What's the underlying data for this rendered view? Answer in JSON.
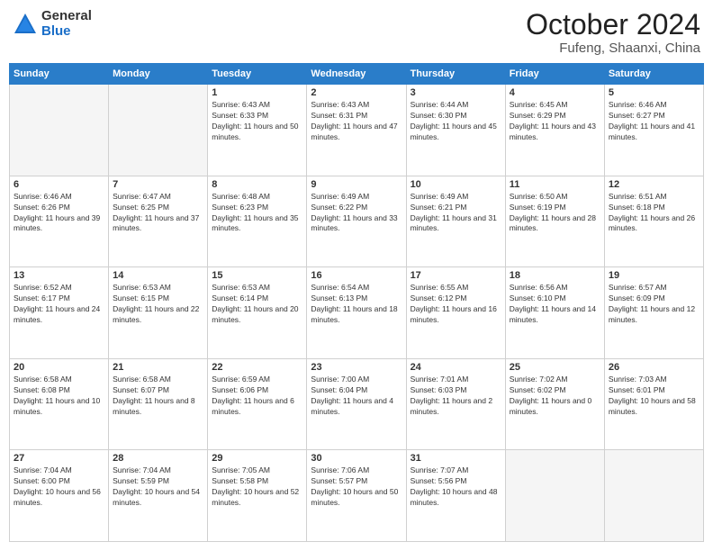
{
  "header": {
    "logo_general": "General",
    "logo_blue": "Blue",
    "month": "October 2024",
    "location": "Fufeng, Shaanxi, China"
  },
  "weekdays": [
    "Sunday",
    "Monday",
    "Tuesday",
    "Wednesday",
    "Thursday",
    "Friday",
    "Saturday"
  ],
  "weeks": [
    [
      {
        "day": "",
        "text": ""
      },
      {
        "day": "",
        "text": ""
      },
      {
        "day": "1",
        "text": "Sunrise: 6:43 AM\nSunset: 6:33 PM\nDaylight: 11 hours and 50 minutes."
      },
      {
        "day": "2",
        "text": "Sunrise: 6:43 AM\nSunset: 6:31 PM\nDaylight: 11 hours and 47 minutes."
      },
      {
        "day": "3",
        "text": "Sunrise: 6:44 AM\nSunset: 6:30 PM\nDaylight: 11 hours and 45 minutes."
      },
      {
        "day": "4",
        "text": "Sunrise: 6:45 AM\nSunset: 6:29 PM\nDaylight: 11 hours and 43 minutes."
      },
      {
        "day": "5",
        "text": "Sunrise: 6:46 AM\nSunset: 6:27 PM\nDaylight: 11 hours and 41 minutes."
      }
    ],
    [
      {
        "day": "6",
        "text": "Sunrise: 6:46 AM\nSunset: 6:26 PM\nDaylight: 11 hours and 39 minutes."
      },
      {
        "day": "7",
        "text": "Sunrise: 6:47 AM\nSunset: 6:25 PM\nDaylight: 11 hours and 37 minutes."
      },
      {
        "day": "8",
        "text": "Sunrise: 6:48 AM\nSunset: 6:23 PM\nDaylight: 11 hours and 35 minutes."
      },
      {
        "day": "9",
        "text": "Sunrise: 6:49 AM\nSunset: 6:22 PM\nDaylight: 11 hours and 33 minutes."
      },
      {
        "day": "10",
        "text": "Sunrise: 6:49 AM\nSunset: 6:21 PM\nDaylight: 11 hours and 31 minutes."
      },
      {
        "day": "11",
        "text": "Sunrise: 6:50 AM\nSunset: 6:19 PM\nDaylight: 11 hours and 28 minutes."
      },
      {
        "day": "12",
        "text": "Sunrise: 6:51 AM\nSunset: 6:18 PM\nDaylight: 11 hours and 26 minutes."
      }
    ],
    [
      {
        "day": "13",
        "text": "Sunrise: 6:52 AM\nSunset: 6:17 PM\nDaylight: 11 hours and 24 minutes."
      },
      {
        "day": "14",
        "text": "Sunrise: 6:53 AM\nSunset: 6:15 PM\nDaylight: 11 hours and 22 minutes."
      },
      {
        "day": "15",
        "text": "Sunrise: 6:53 AM\nSunset: 6:14 PM\nDaylight: 11 hours and 20 minutes."
      },
      {
        "day": "16",
        "text": "Sunrise: 6:54 AM\nSunset: 6:13 PM\nDaylight: 11 hours and 18 minutes."
      },
      {
        "day": "17",
        "text": "Sunrise: 6:55 AM\nSunset: 6:12 PM\nDaylight: 11 hours and 16 minutes."
      },
      {
        "day": "18",
        "text": "Sunrise: 6:56 AM\nSunset: 6:10 PM\nDaylight: 11 hours and 14 minutes."
      },
      {
        "day": "19",
        "text": "Sunrise: 6:57 AM\nSunset: 6:09 PM\nDaylight: 11 hours and 12 minutes."
      }
    ],
    [
      {
        "day": "20",
        "text": "Sunrise: 6:58 AM\nSunset: 6:08 PM\nDaylight: 11 hours and 10 minutes."
      },
      {
        "day": "21",
        "text": "Sunrise: 6:58 AM\nSunset: 6:07 PM\nDaylight: 11 hours and 8 minutes."
      },
      {
        "day": "22",
        "text": "Sunrise: 6:59 AM\nSunset: 6:06 PM\nDaylight: 11 hours and 6 minutes."
      },
      {
        "day": "23",
        "text": "Sunrise: 7:00 AM\nSunset: 6:04 PM\nDaylight: 11 hours and 4 minutes."
      },
      {
        "day": "24",
        "text": "Sunrise: 7:01 AM\nSunset: 6:03 PM\nDaylight: 11 hours and 2 minutes."
      },
      {
        "day": "25",
        "text": "Sunrise: 7:02 AM\nSunset: 6:02 PM\nDaylight: 11 hours and 0 minutes."
      },
      {
        "day": "26",
        "text": "Sunrise: 7:03 AM\nSunset: 6:01 PM\nDaylight: 10 hours and 58 minutes."
      }
    ],
    [
      {
        "day": "27",
        "text": "Sunrise: 7:04 AM\nSunset: 6:00 PM\nDaylight: 10 hours and 56 minutes."
      },
      {
        "day": "28",
        "text": "Sunrise: 7:04 AM\nSunset: 5:59 PM\nDaylight: 10 hours and 54 minutes."
      },
      {
        "day": "29",
        "text": "Sunrise: 7:05 AM\nSunset: 5:58 PM\nDaylight: 10 hours and 52 minutes."
      },
      {
        "day": "30",
        "text": "Sunrise: 7:06 AM\nSunset: 5:57 PM\nDaylight: 10 hours and 50 minutes."
      },
      {
        "day": "31",
        "text": "Sunrise: 7:07 AM\nSunset: 5:56 PM\nDaylight: 10 hours and 48 minutes."
      },
      {
        "day": "",
        "text": ""
      },
      {
        "day": "",
        "text": ""
      }
    ]
  ]
}
